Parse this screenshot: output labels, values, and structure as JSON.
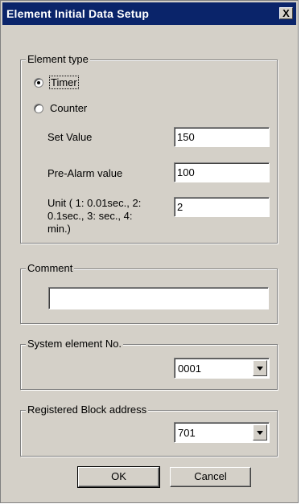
{
  "dialog": {
    "title": "Element Initial Data Setup",
    "close_glyph": "X"
  },
  "element_type": {
    "legend": "Element type",
    "options": [
      {
        "label": "Timer",
        "selected": true
      },
      {
        "label": "Counter",
        "selected": false
      }
    ],
    "set_value": {
      "label": "Set Value",
      "value": "150"
    },
    "pre_alarm": {
      "label": "Pre-Alarm value",
      "value": "100"
    },
    "unit": {
      "label_lines": [
        "Unit ( 1: 0.01sec., 2:",
        "0.1sec., 3: sec., 4:",
        "min.)"
      ],
      "value": "2"
    }
  },
  "comment": {
    "legend": "Comment",
    "value": ""
  },
  "system_element": {
    "legend": "System element No.",
    "selected": "0001"
  },
  "registered_block": {
    "legend": "Registered Block address",
    "selected": "701"
  },
  "buttons": {
    "ok": "OK",
    "cancel": "Cancel"
  },
  "colors": {
    "title_bar": "#0a246a",
    "dialog_bg": "#d4d0c8"
  }
}
